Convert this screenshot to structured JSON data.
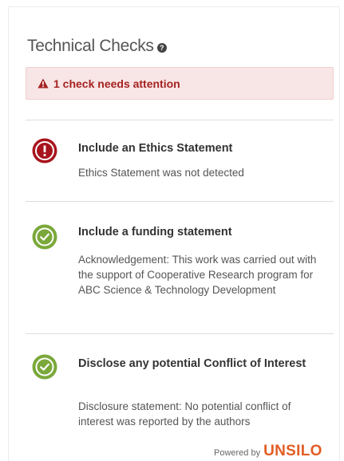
{
  "header": {
    "title": "Technical Checks",
    "help_icon": "help-circle-icon"
  },
  "alert": {
    "icon": "warning-triangle-icon",
    "text": "1 check needs attention",
    "color": "#a52222",
    "background": "#f8e5e5"
  },
  "checks": [
    {
      "status": "error",
      "icon": "error-exclamation-icon",
      "title": "Include an Ethics Statement",
      "description": "Ethics Statement was not detected"
    },
    {
      "status": "pass",
      "icon": "check-circle-icon",
      "title": "Include a funding statement",
      "description": "Acknowledgement: This work was carried out with the support of Cooperative Research program for ABC Science & Technology Development"
    },
    {
      "status": "pass",
      "icon": "check-circle-icon",
      "title": "Disclose any potential Conflict of Interest",
      "description": "Disclosure statement: No potential conflict of interest was reported by the authors"
    }
  ],
  "footer": {
    "powered_by": "Powered by",
    "brand": "UNSILO"
  },
  "colors": {
    "error": "#a8141e",
    "pass": "#7aa83a",
    "brand": "#e25d24"
  }
}
